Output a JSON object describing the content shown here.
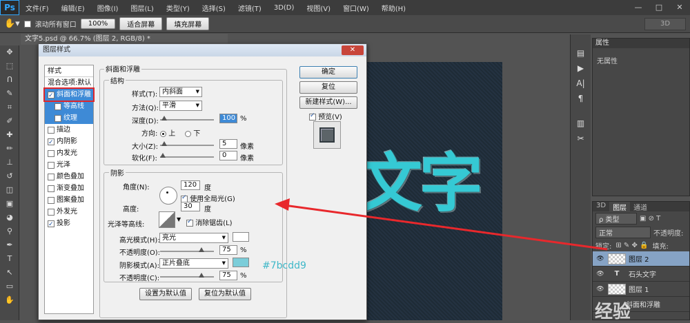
{
  "app": {
    "logo": "Ps",
    "menu": [
      "文件(F)",
      "编辑(E)",
      "图像(I)",
      "图层(L)",
      "类型(Y)",
      "选择(S)",
      "滤镜(T)",
      "3D(D)",
      "视图(V)",
      "窗口(W)",
      "帮助(H)"
    ],
    "window_controls": [
      "—",
      "□",
      "✕"
    ]
  },
  "options_bar": {
    "scroll_all_label": "滚动所有窗口",
    "zoom_100": "100%",
    "fit_screen": "适合屏幕",
    "fill_screen": "填充屏幕",
    "mode_3d": "3D"
  },
  "document": {
    "tab_title": "文字5.psd @ 66.7% (图层 2, RGB/8) *",
    "canvas_text": "文字"
  },
  "dialog": {
    "title": "图层样式",
    "close": "✕",
    "styles_header": "样式",
    "blend_options": "混合选项:默认",
    "styles": [
      {
        "label": "斜面和浮雕",
        "checked": true,
        "selected": true
      },
      {
        "label": "等高线",
        "checked": false,
        "sub": true
      },
      {
        "label": "纹理",
        "checked": false,
        "sub": true
      },
      {
        "label": "描边",
        "checked": false
      },
      {
        "label": "内阴影",
        "checked": true
      },
      {
        "label": "内发光",
        "checked": false
      },
      {
        "label": "光泽",
        "checked": false
      },
      {
        "label": "颜色叠加",
        "checked": false
      },
      {
        "label": "渐变叠加",
        "checked": false
      },
      {
        "label": "图案叠加",
        "checked": false
      },
      {
        "label": "外发光",
        "checked": false
      },
      {
        "label": "投影",
        "checked": true
      }
    ],
    "bevel_title": "斜面和浮雕",
    "structure": {
      "title": "结构",
      "style_label": "样式(T):",
      "style_value": "内斜面",
      "method_label": "方法(Q):",
      "method_value": "平滑",
      "depth_label": "深度(D):",
      "depth_value": "100",
      "depth_unit": "%",
      "direction_label": "方向:",
      "dir_up": "上",
      "dir_down": "下",
      "size_label": "大小(Z):",
      "size_value": "5",
      "size_unit": "像素",
      "soften_label": "软化(F):",
      "soften_value": "0",
      "soften_unit": "像素"
    },
    "shading": {
      "title": "阴影",
      "angle_label": "角度(N):",
      "angle_value": "120",
      "angle_unit": "度",
      "global_light": "使用全局光(G)",
      "altitude_label": "高度:",
      "altitude_value": "30",
      "altitude_unit": "度",
      "gloss_label": "光泽等高线:",
      "antialias": "消除锯齿(L)",
      "highlight_label": "高光模式(H):",
      "highlight_value": "亮光",
      "highlight_color": "#ffffff",
      "opacity1_label": "不透明度(O):",
      "opacity1_value": "75",
      "opacity1_unit": "%",
      "shadow_label": "阴影模式(A):",
      "shadow_value": "正片叠底",
      "shadow_color": "#7bcdd9",
      "opacity2_label": "不透明度(C):",
      "opacity2_value": "75",
      "opacity2_unit": "%"
    },
    "set_default": "设置为默认值",
    "reset_default": "复位为默认值",
    "ok": "确定",
    "reset": "复位",
    "new_style": "新建样式(W)...",
    "preview": "预览(V)"
  },
  "annotation": "#7bcdd9",
  "props_panel": {
    "title": "属性",
    "empty": "无属性"
  },
  "layers_panel": {
    "tabs": [
      "3D",
      "图层",
      "通道"
    ],
    "kind": "ρ 类型",
    "blend": "正常",
    "opacity_label": "不透明度:",
    "lock_label": "锁定:",
    "fill_label": "填充:",
    "layers": [
      {
        "name": "图层 2",
        "selected": true,
        "type": "pixel"
      },
      {
        "name": "石头文字",
        "selected": false,
        "type": "text"
      },
      {
        "name": "图层 1",
        "selected": false,
        "type": "pixel"
      },
      {
        "name": "斜面和浮雕",
        "selected": false,
        "type": "effect"
      }
    ]
  },
  "watermark": "经验"
}
